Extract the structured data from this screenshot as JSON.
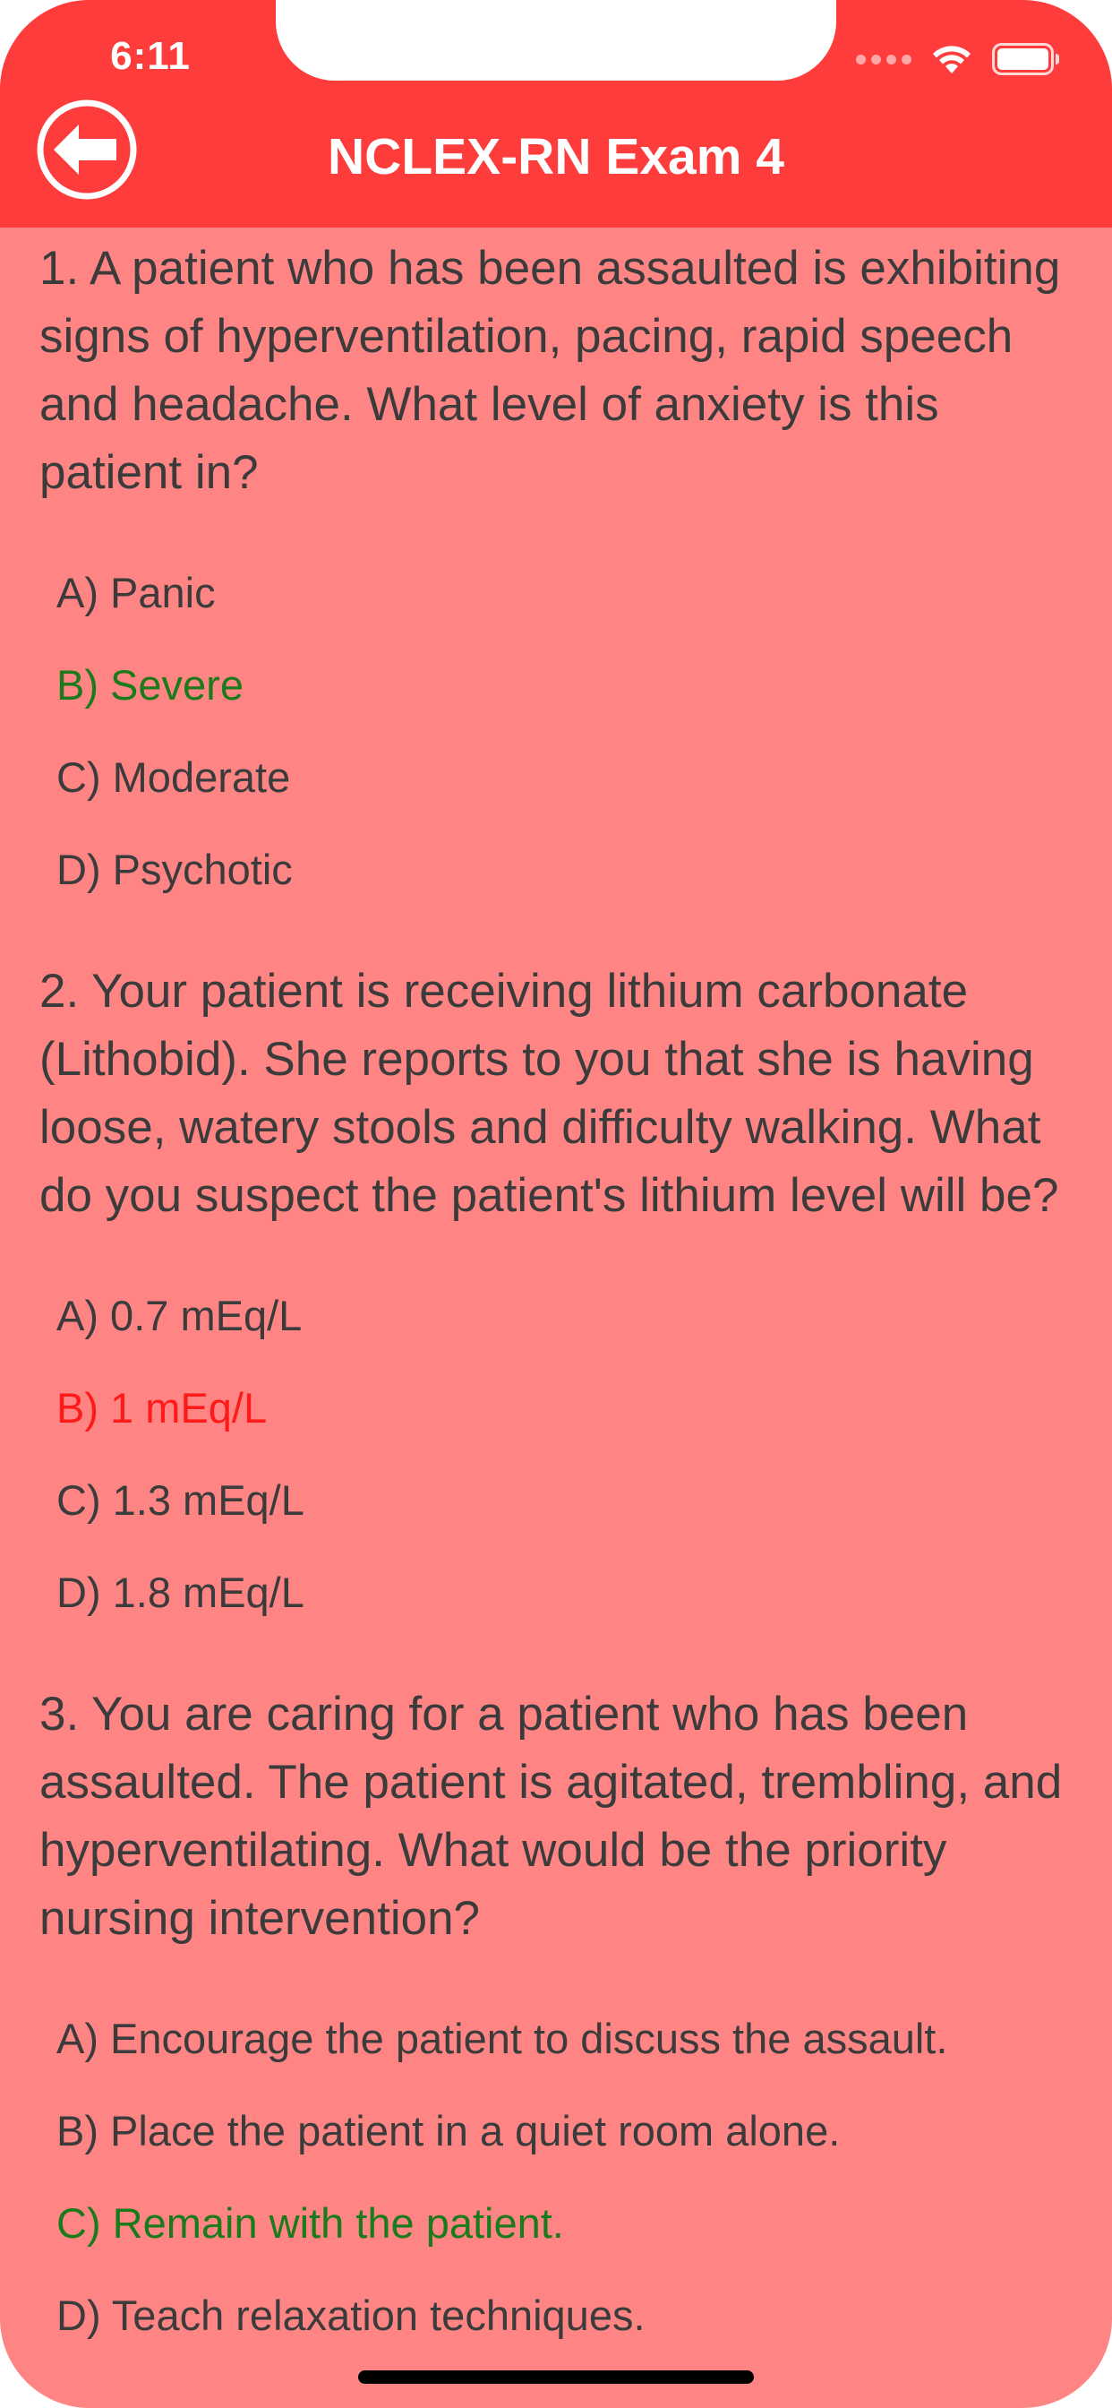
{
  "status_bar": {
    "time": "6:11"
  },
  "header": {
    "title": "NCLEX-RN Exam 4",
    "back_icon": "arrow-left-circle-icon"
  },
  "colors": {
    "header_bg": "#ff3c3c",
    "content_bg": "#ff8585",
    "correct": "#1b7a1b",
    "wrong": "#ff1a1a",
    "text": "#3b3b3b"
  },
  "questions": [
    {
      "text": "1. A patient who has been assaulted is exhibiting signs of hyperventilation, pacing, rapid speech and headache. What level of anxiety is this patient in?",
      "options": [
        {
          "label": "A) Panic",
          "state": "normal"
        },
        {
          "label": "B) Severe",
          "state": "correct"
        },
        {
          "label": "C) Moderate",
          "state": "normal"
        },
        {
          "label": "D) Psychotic",
          "state": "normal"
        }
      ]
    },
    {
      "text": "2. Your patient is receiving lithium carbonate (Lithobid). She reports to you that she is having loose, watery stools and difficulty walking. What do you suspect the patient's lithium level will be?",
      "options": [
        {
          "label": "A) 0.7 mEq/L",
          "state": "normal"
        },
        {
          "label": "B) 1 mEq/L",
          "state": "wrong"
        },
        {
          "label": "C) 1.3 mEq/L",
          "state": "normal"
        },
        {
          "label": "D) 1.8 mEq/L",
          "state": "normal"
        }
      ]
    },
    {
      "text": "3. You are caring for a patient who has been assaulted. The patient is agitated, trembling, and hyperventilating. What would be the priority nursing intervention?",
      "options": [
        {
          "label": "A) Encourage the patient to discuss the assault.",
          "state": "normal"
        },
        {
          "label": "B) Place the patient in a quiet room alone.",
          "state": "normal"
        },
        {
          "label": "C) Remain with the patient.",
          "state": "correct"
        },
        {
          "label": "D) Teach relaxation techniques.",
          "state": "normal"
        }
      ]
    }
  ]
}
